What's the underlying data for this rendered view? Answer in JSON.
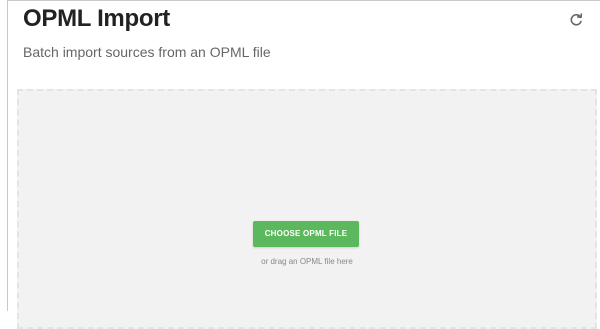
{
  "header": {
    "title": "OPML Import",
    "subtitle": "Batch import sources from an OPML file",
    "refresh_icon": "refresh-icon"
  },
  "dropzone": {
    "button_label": "CHOOSE OPML FILE",
    "hint": "or drag an OPML file here"
  },
  "colors": {
    "accent_green": "#5cb85c",
    "dropzone_bg": "#f2f2f2",
    "title_text": "#222222",
    "subtitle_text": "#666666"
  }
}
